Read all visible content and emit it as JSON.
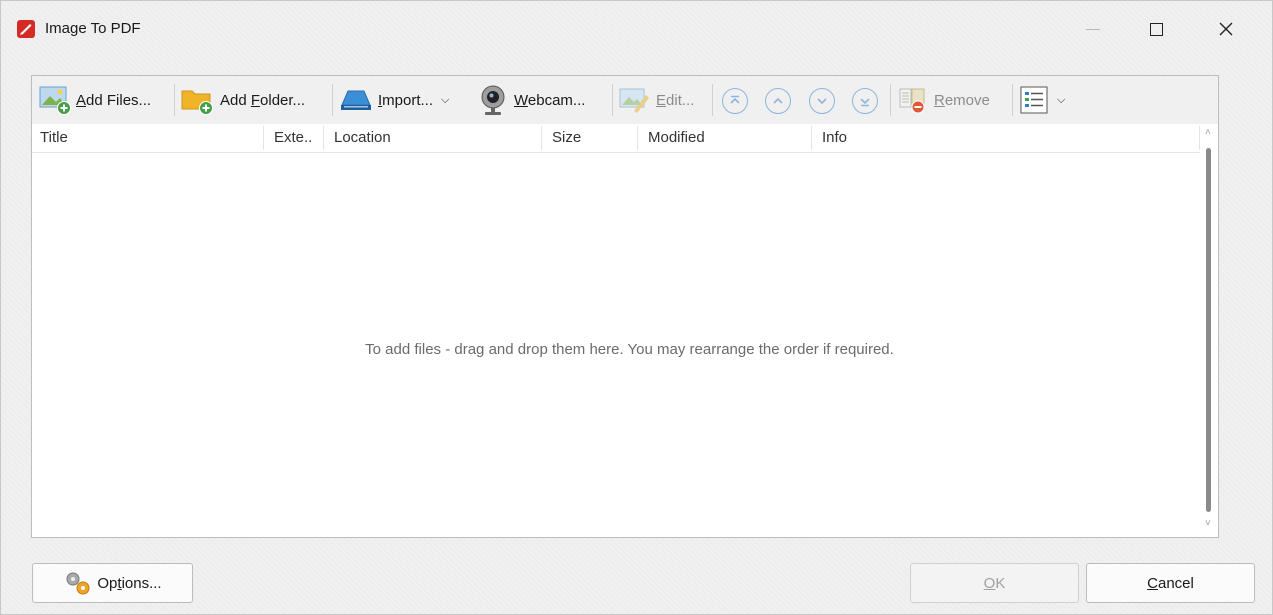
{
  "window": {
    "title": "Image To PDF"
  },
  "toolbar": {
    "add_files": {
      "pre": "",
      "key": "A",
      "post": "dd Files..."
    },
    "add_folder": {
      "pre": "Add ",
      "key": "F",
      "post": "older..."
    },
    "import": {
      "pre": "",
      "key": "I",
      "post": "mport..."
    },
    "webcam": {
      "pre": "",
      "key": "W",
      "post": "ebcam..."
    },
    "edit": {
      "pre": "",
      "key": "E",
      "post": "dit..."
    },
    "remove": {
      "pre": "",
      "key": "R",
      "post": "emove"
    }
  },
  "columns": [
    "Title",
    "Exte..",
    "Location",
    "Size",
    "Modified",
    "Info"
  ],
  "list": {
    "empty_message": "To add files - drag and drop them here. You may rearrange the order if required."
  },
  "footer": {
    "options": {
      "pre": "Op",
      "key": "t",
      "post": "ions..."
    },
    "ok": {
      "pre": "",
      "key": "O",
      "post": "K"
    },
    "cancel": {
      "pre": "",
      "key": "C",
      "post": "ancel"
    }
  },
  "colors": {
    "app_icon": "#d42b27",
    "folder": "#f0b429",
    "nav_circle": "#8fb4dd",
    "add_badge": "#43a047",
    "remove_badge": "#e0573a"
  }
}
